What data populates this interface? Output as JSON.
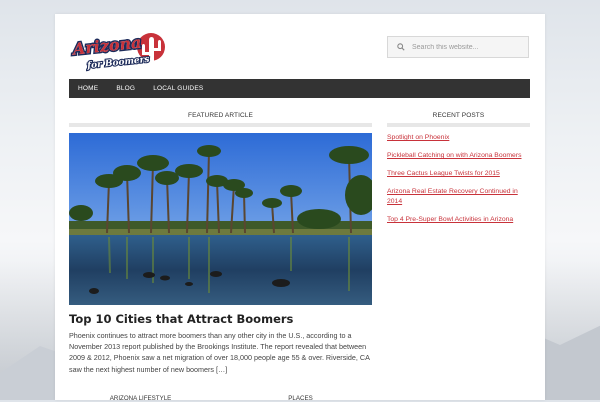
{
  "brand": {
    "logo_line1": "Arizona",
    "logo_line2": "for Boomers",
    "colors": {
      "primary": "#c8323a",
      "dark": "#333333",
      "accent_navy": "#1d2b5a"
    }
  },
  "search": {
    "placeholder": "Search this website...",
    "icon": "search-icon"
  },
  "nav": {
    "items": [
      "HOME",
      "BLOG",
      "LOCAL GUIDES"
    ]
  },
  "featured": {
    "heading": "FEATURED ARTICLE",
    "title": "Top 10 Cities that Attract Boomers",
    "excerpt": "Phoenix continues to attract more boomers than any other city in the U.S., according to a November 2013 report published by the Brookings Institute. The report revealed that between 2009 & 2012, Phoenix saw a net migration of over 18,000 people age 55 & over. Riverside, CA saw the next highest number of new boomers […]"
  },
  "recent_posts": {
    "heading": "RECENT POSTS",
    "items": [
      "Spotlight on Phoenix",
      "Pickleball Catching on with Arizona Boomers",
      "Three Cactus League Twists for 2015",
      "Arizona Real Estate Recovery Continued in 2014",
      "Top 4 Pre-Super Bowl Activities in Arizona"
    ]
  },
  "bottom_sections": [
    "ARIZONA LIFESTYLE",
    "PLACES"
  ]
}
